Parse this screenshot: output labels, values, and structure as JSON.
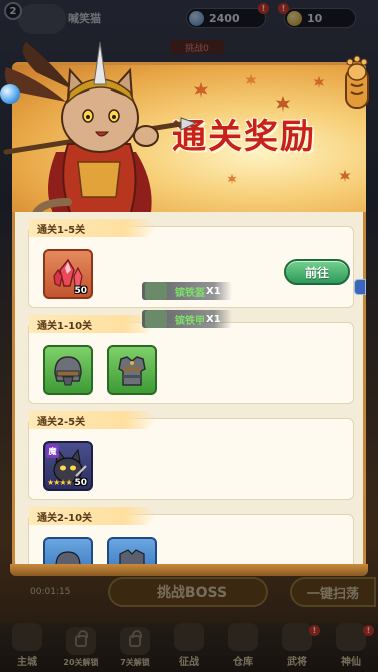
{
  "hud": {
    "level": "2",
    "player_name": "喊笑猫",
    "gems": "2400",
    "gold": "10",
    "alert_mark": "!",
    "banner": "挑战0"
  },
  "modal": {
    "title": "通关奖励",
    "cards": [
      {
        "title": "通关1-5关",
        "items": [
          {
            "icon": "red-crystal-icon",
            "count": "50"
          }
        ],
        "action": "前往"
      },
      {
        "title": "通关1-10关",
        "items": [
          {
            "icon": "iron-helmet-icon"
          },
          {
            "icon": "iron-armor-icon"
          }
        ]
      },
      {
        "title": "通关2-5关",
        "items": [
          {
            "icon": "hero-cat-icon",
            "count": "50",
            "rarity": "魔",
            "stars": "★★★★"
          }
        ]
      },
      {
        "title": "通关2-10关",
        "items": [
          {
            "icon": "blue-item-1-icon"
          },
          {
            "icon": "blue-item-2-icon"
          }
        ]
      }
    ]
  },
  "toasts": [
    {
      "name": "镔铁盔",
      "qty": "X1"
    },
    {
      "name": "镔铁甲",
      "qty": "X1"
    }
  ],
  "bottom": {
    "timer": "00:01:15",
    "boss_button": "挑战BOSS",
    "sweep_button": "一键扫荡",
    "nav": [
      {
        "label": "主城",
        "icon": "city-icon"
      },
      {
        "label": "20关解锁",
        "icon": "lock-icon",
        "small": true
      },
      {
        "label": "7关解锁",
        "icon": "lock-icon",
        "small": true
      },
      {
        "label": "征战",
        "icon": "battle-icon"
      },
      {
        "label": "仓库",
        "icon": "warehouse-icon"
      },
      {
        "label": "武将",
        "icon": "general-icon"
      },
      {
        "label": "神仙",
        "icon": "immortal-icon"
      }
    ]
  },
  "colors": {
    "title_red": "#c8211c",
    "go_green": "#2e9a5a",
    "toast_green": "#7ee06a"
  }
}
